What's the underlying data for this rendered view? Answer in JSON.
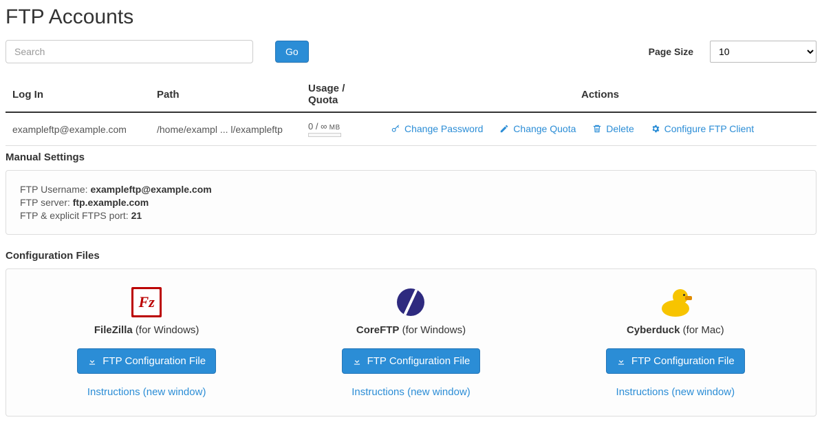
{
  "title": "FTP Accounts",
  "search": {
    "placeholder": "Search",
    "go": "Go"
  },
  "page_size": {
    "label": "Page Size",
    "value": "10"
  },
  "table": {
    "headers": {
      "login": "Log In",
      "path": "Path",
      "usage_quota": "Usage  /  Quota",
      "actions": "Actions"
    },
    "rows": [
      {
        "login": "exampleftp@example.com",
        "path": "/home/exampl ... l/exampleftp",
        "usage": "0 / ",
        "quota_inf": "∞",
        "mb": " MB"
      }
    ]
  },
  "actions": {
    "change_password": "Change Password",
    "change_quota": "Change Quota",
    "delete": "Delete",
    "configure": "Configure FTP Client"
  },
  "manual": {
    "heading": "Manual Settings",
    "username_label": "FTP Username: ",
    "username_value": "exampleftp@example.com",
    "server_label": "FTP server: ",
    "server_value": "ftp.example.com",
    "port_label": "FTP & explicit FTPS port:  ",
    "port_value": "21"
  },
  "config": {
    "heading": "Configuration Files",
    "btn_label": "FTP Configuration File",
    "instr_label": "Instructions (new window)",
    "clients": [
      {
        "name": "FileZilla",
        "platform": " (for Windows)"
      },
      {
        "name": "CoreFTP",
        "platform": " (for Windows)"
      },
      {
        "name": "Cyberduck",
        "platform": " (for Mac)"
      }
    ]
  }
}
